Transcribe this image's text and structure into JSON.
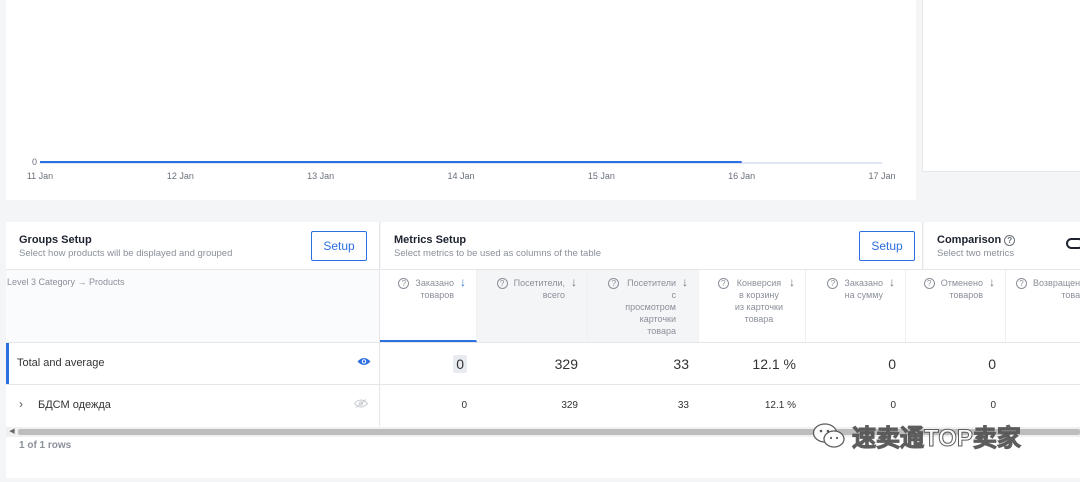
{
  "chart_data": {
    "type": "line",
    "x": [
      "11 Jan",
      "12 Jan",
      "13 Jan",
      "14 Jan",
      "15 Jan",
      "16 Jan",
      "17 Jan"
    ],
    "series": [
      {
        "values": [
          0,
          0,
          0,
          0,
          0,
          0,
          0
        ]
      }
    ],
    "yticks": [
      "0"
    ],
    "accent": "#2c6fe0"
  },
  "groups": {
    "title": "Groups Setup",
    "subtitle": "Select how products will be displayed and grouped",
    "button": "Setup"
  },
  "metrics": {
    "title": "Metrics Setup",
    "subtitle": "Select metrics to be used as columns of the table",
    "button": "Setup"
  },
  "comparison": {
    "title": "Comparison",
    "subtitle": "Select two metrics"
  },
  "table": {
    "group_header": "Level 3 Category → Products",
    "columns": [
      {
        "label": "Заказано товаров",
        "lines": [
          "Заказано",
          "товаров"
        ],
        "sort_icon": "arrow-down-icon"
      },
      {
        "label": "Посетители, всего",
        "lines": [
          "Посетители,",
          "всего"
        ],
        "sort_icon": "arrow-down-icon"
      },
      {
        "label": "Посетители с просмотром карточки товара",
        "lines": [
          "Посетители",
          "с",
          "просмотром",
          "карточки",
          "товара"
        ],
        "sort_icon": "arrow-down-icon"
      },
      {
        "label": "Конверсия в корзину из карточки товара",
        "lines": [
          "Конверсия",
          "в корзину",
          "из карточки",
          "товара"
        ],
        "sort_icon": "arrow-down-icon"
      },
      {
        "label": "Заказано на сумму",
        "lines": [
          "Заказано",
          "на сумму"
        ],
        "sort_icon": "arrow-down-icon"
      },
      {
        "label": "Отменено товаров",
        "lines": [
          "Отменено",
          "товаров"
        ],
        "sort_icon": "arrow-down-icon"
      },
      {
        "label": "Возвращено товаров",
        "lines": [
          "Возвращен",
          "това"
        ],
        "sort_icon": "arrow-down-icon"
      }
    ],
    "total_row": {
      "label": "Total and average",
      "values": [
        "0",
        "329",
        "33",
        "12.1 %",
        "0",
        "0",
        ""
      ]
    },
    "rows": [
      {
        "label": "БДСМ одежда",
        "values": [
          "0",
          "329",
          "33",
          "12.1 %",
          "0",
          "0",
          ""
        ]
      }
    ],
    "row_count": "1 of 1 rows"
  },
  "watermark": {
    "text": "速卖通TOP卖家"
  }
}
